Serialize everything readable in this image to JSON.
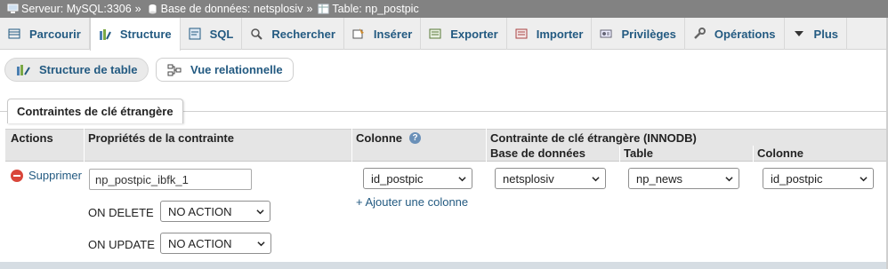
{
  "breadcrumb": {
    "server": "Serveur: MySQL:3306",
    "database": "Base de données: netsplosiv",
    "table": "Table: np_postpic",
    "separator": "»"
  },
  "tabs": [
    {
      "label": "Parcourir",
      "icon": "browse-icon"
    },
    {
      "label": "Structure",
      "icon": "structure-icon",
      "active": true
    },
    {
      "label": "SQL",
      "icon": "sql-icon"
    },
    {
      "label": "Rechercher",
      "icon": "search-icon"
    },
    {
      "label": "Insérer",
      "icon": "insert-icon"
    },
    {
      "label": "Exporter",
      "icon": "export-icon"
    },
    {
      "label": "Importer",
      "icon": "import-icon"
    },
    {
      "label": "Privilèges",
      "icon": "privileges-icon"
    },
    {
      "label": "Opérations",
      "icon": "wrench-icon"
    },
    {
      "label": "Plus",
      "icon": "caret-down-icon"
    }
  ],
  "subnav": {
    "structure_label": "Structure de table",
    "relation_label": "Vue relationnelle"
  },
  "fieldset": {
    "legend": "Contraintes de clé étrangère"
  },
  "table": {
    "headers": {
      "actions": "Actions",
      "properties": "Propriétés de la contrainte",
      "column": "Colonne",
      "fk_constraint": "Contrainte de clé étrangère (INNODB)",
      "database": "Base de données",
      "table": "Table",
      "fk_column": "Colonne"
    },
    "row": {
      "delete_label": "Supprimer",
      "constraint_name": "np_postpic_ibfk_1",
      "on_delete_label": "ON DELETE",
      "on_delete_value": "NO ACTION",
      "on_update_label": "ON UPDATE",
      "on_update_value": "NO ACTION",
      "column_value": "id_postpic",
      "add_column_label": "+ Ajouter une colonne",
      "ref_database": "netsplosiv",
      "ref_table": "np_news",
      "ref_column": "id_postpic"
    }
  },
  "colors": {
    "link": "#235a81",
    "topbar": "#828282",
    "header_bg": "#e5e5e5",
    "delete_red": "#d9463a"
  }
}
